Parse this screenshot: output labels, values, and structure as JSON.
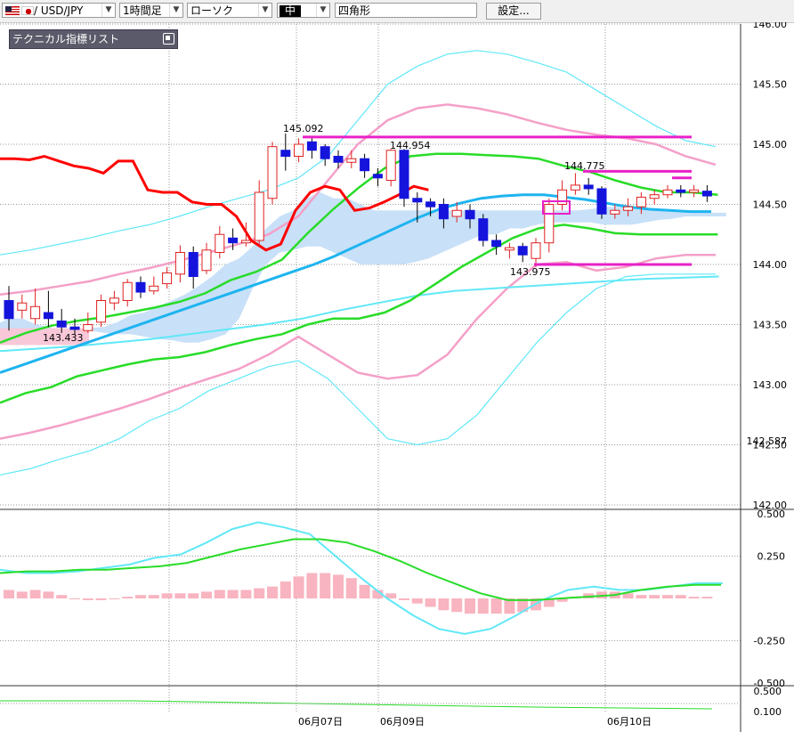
{
  "toolbar": {
    "symbol": "/ USD/JPY",
    "period": "1時間足",
    "chart_style": "ローソク",
    "size": "中",
    "draw_tool": "四角形",
    "settings_label": "設定..."
  },
  "indicator_panel": {
    "title": "テクニカル指標リスト"
  },
  "colors": {
    "candle_up": "#e02020",
    "candle_down": "#1414dc",
    "cloud": "#c8e0f8",
    "ma_red": "#ff0000",
    "ma_cyan": "#1eb4f0",
    "bb_pink": "#f4a0c8",
    "bb_outer": "#60e8f8",
    "ma_green": "#28dc28",
    "line_magenta": "#e820c8",
    "macd_hist": "#f8b4c0",
    "grid": "#999999"
  },
  "chart_data": [
    {
      "type": "candlestick",
      "price_axis": {
        "ylim": [
          142.0,
          146.0
        ],
        "ticks": [
          "146.00",
          "145.50",
          "145.00",
          "144.50",
          "144.00",
          "143.50",
          "143.00",
          "142.50",
          "142.00"
        ],
        "current_price_label": "142.587"
      },
      "date_labels": [
        "06月07日",
        "06月09日",
        "06月10日"
      ],
      "annotations": [
        {
          "label": "145.092",
          "value": 145.092
        },
        {
          "label": "144.954",
          "value": 144.954
        },
        {
          "label": "144.775",
          "value": 144.775
        },
        {
          "label": "143.975",
          "value": 143.975
        },
        {
          "label": "143.433",
          "value": 143.433
        }
      ],
      "horizontal_lines": [
        145.06,
        144.775,
        144.72,
        144.0
      ],
      "candles": [
        [
          143.7,
          143.55,
          143.82,
          143.45
        ],
        [
          143.62,
          143.68,
          143.75,
          143.55
        ],
        [
          143.55,
          143.65,
          143.8,
          143.5
        ],
        [
          143.6,
          143.55,
          143.78,
          143.48
        ],
        [
          143.53,
          143.48,
          143.63,
          143.43
        ],
        [
          143.48,
          143.46,
          143.55,
          143.42
        ],
        [
          143.45,
          143.5,
          143.6,
          143.43
        ],
        [
          143.52,
          143.7,
          143.75,
          143.48
        ],
        [
          143.68,
          143.72,
          143.78,
          143.62
        ],
        [
          143.7,
          143.85,
          143.88,
          143.65
        ],
        [
          143.85,
          143.77,
          143.9,
          143.72
        ],
        [
          143.78,
          143.82,
          143.9,
          143.75
        ],
        [
          143.84,
          143.93,
          143.98,
          143.8
        ],
        [
          143.92,
          144.1,
          144.16,
          143.85
        ],
        [
          144.1,
          143.9,
          144.15,
          143.8
        ],
        [
          143.95,
          144.12,
          144.18,
          143.92
        ],
        [
          144.1,
          144.25,
          144.32,
          144.05
        ],
        [
          144.22,
          144.18,
          144.3,
          144.12
        ],
        [
          144.18,
          144.2,
          144.35,
          144.15
        ],
        [
          144.2,
          144.6,
          144.7,
          144.15
        ],
        [
          144.55,
          144.98,
          145.02,
          144.5
        ],
        [
          144.95,
          144.9,
          145.09,
          144.78
        ],
        [
          144.9,
          145.0,
          145.05,
          144.85
        ],
        [
          145.02,
          144.95,
          145.05,
          144.88
        ],
        [
          144.98,
          144.88,
          145.0,
          144.82
        ],
        [
          144.9,
          144.85,
          144.95,
          144.8
        ],
        [
          144.85,
          144.88,
          144.95,
          144.8
        ],
        [
          144.88,
          144.78,
          144.92,
          144.72
        ],
        [
          144.75,
          144.72,
          144.8,
          144.65
        ],
        [
          144.7,
          144.95,
          144.96,
          144.65
        ],
        [
          144.95,
          144.55,
          144.96,
          144.48
        ],
        [
          144.55,
          144.52,
          144.6,
          144.35
        ],
        [
          144.52,
          144.48,
          144.55,
          144.4
        ],
        [
          144.5,
          144.38,
          144.55,
          144.3
        ],
        [
          144.4,
          144.45,
          144.52,
          144.35
        ],
        [
          144.45,
          144.38,
          144.5,
          144.3
        ],
        [
          144.38,
          144.2,
          144.42,
          144.15
        ],
        [
          144.2,
          144.15,
          144.25,
          144.08
        ],
        [
          144.12,
          144.14,
          144.18,
          144.05
        ],
        [
          144.15,
          144.08,
          144.18,
          144.02
        ],
        [
          144.05,
          144.18,
          144.22,
          143.98
        ],
        [
          144.18,
          144.5,
          144.55,
          144.1
        ],
        [
          144.5,
          144.62,
          144.7,
          144.45
        ],
        [
          144.62,
          144.66,
          144.76,
          144.58
        ],
        [
          144.66,
          144.63,
          144.72,
          144.58
        ],
        [
          144.63,
          144.42,
          144.65,
          144.38
        ],
        [
          144.42,
          144.45,
          144.5,
          144.38
        ],
        [
          144.45,
          144.48,
          144.55,
          144.4
        ],
        [
          144.48,
          144.56,
          144.6,
          144.42
        ],
        [
          144.55,
          144.58,
          144.62,
          144.5
        ],
        [
          144.58,
          144.62,
          144.66,
          144.55
        ],
        [
          144.62,
          144.6,
          144.66,
          144.56
        ],
        [
          144.6,
          144.62,
          144.66,
          144.56
        ],
        [
          144.61,
          144.57,
          144.66,
          144.52
        ]
      ],
      "indicators": {
        "ma_red": [
          144.88,
          144.88,
          144.87,
          144.9,
          144.86,
          144.82,
          144.8,
          144.76,
          144.86,
          144.86,
          144.62,
          144.6,
          144.6,
          144.52,
          144.5,
          144.5,
          144.4,
          144.2,
          144.12,
          144.17,
          144.45,
          144.6,
          144.65,
          144.62,
          144.45,
          144.47,
          144.52,
          144.58,
          144.65,
          144.62
        ],
        "ma_cyan": [
          143.1,
          143.16,
          143.22,
          143.28,
          143.34,
          143.4,
          143.46,
          143.52,
          143.58,
          143.64,
          143.7,
          143.76,
          143.82,
          143.88,
          143.94,
          144.0,
          144.07,
          144.15,
          144.23,
          144.31,
          144.39,
          144.46,
          144.51,
          144.55,
          144.57,
          144.58,
          144.58,
          144.56,
          144.54,
          144.51,
          144.48,
          144.46,
          144.45,
          144.44,
          144.44
        ],
        "ma_green_1": [
          143.35,
          143.43,
          143.49,
          143.53,
          143.56,
          143.6,
          143.64,
          143.69,
          143.76,
          143.87,
          143.94,
          144.04,
          144.26,
          144.46,
          144.64,
          144.8,
          144.9,
          144.92,
          144.92,
          144.91,
          144.9,
          144.88,
          144.82,
          144.77,
          144.7,
          144.64,
          144.6,
          144.6,
          144.58
        ],
        "ma_green_2": [
          142.85,
          142.93,
          142.98,
          143.07,
          143.12,
          143.17,
          143.21,
          143.23,
          143.27,
          143.33,
          143.38,
          143.42,
          143.5,
          143.55,
          143.55,
          143.6,
          143.7,
          143.84,
          143.98,
          144.1,
          144.22,
          144.3,
          144.33,
          144.3,
          144.26,
          144.25,
          144.25,
          144.25,
          144.25
        ]
      },
      "macd_panel": {
        "yticks": [
          "0.500",
          "0.250",
          "-0.250",
          "-0.500"
        ],
        "macd": [
          0.17,
          0.15,
          0.15,
          0.16,
          0.18,
          0.2,
          0.24,
          0.26,
          0.33,
          0.41,
          0.45,
          0.42,
          0.38,
          0.25,
          0.12,
          0.0,
          -0.1,
          -0.18,
          -0.21,
          -0.18,
          -0.1,
          -0.01,
          0.05,
          0.07,
          0.05,
          0.05,
          0.07,
          0.09,
          0.09
        ],
        "signal": [
          0.15,
          0.16,
          0.16,
          0.17,
          0.17,
          0.18,
          0.19,
          0.21,
          0.25,
          0.29,
          0.32,
          0.35,
          0.35,
          0.33,
          0.28,
          0.22,
          0.15,
          0.09,
          0.03,
          -0.01,
          -0.01,
          0.0,
          0.01,
          0.02,
          0.05,
          0.07,
          0.08,
          0.08
        ]
      },
      "lower_panel": {
        "yticks": [
          "0.500",
          "0.100"
        ]
      }
    }
  ]
}
